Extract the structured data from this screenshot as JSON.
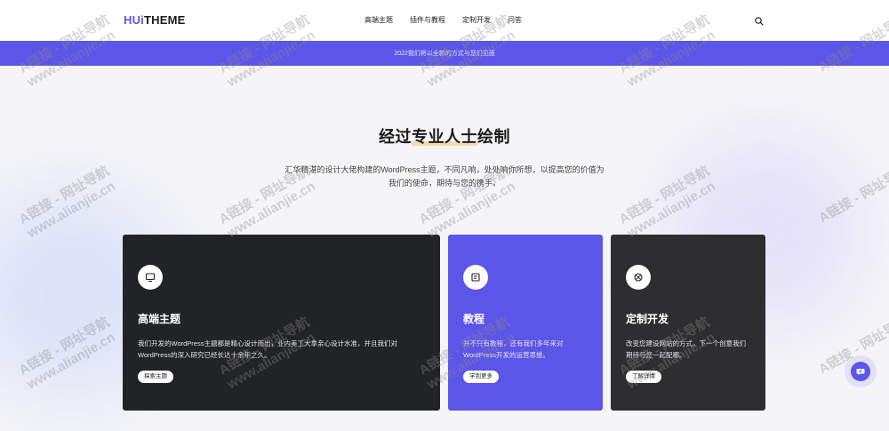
{
  "header": {
    "logo_accent": "HUi",
    "logo_rest": "THEME",
    "nav": [
      "高端主题",
      "插件与教程",
      "定制开发",
      "问答"
    ]
  },
  "announcement": "2022我们将以全新的方式与您们见面",
  "hero": {
    "title_prefix": "经过",
    "title_highlight": "专业人士",
    "title_suffix": "绘制",
    "description": "汇华精湛的设计大佬构建的WordPress主题，不同凡响，处处响你所想，以提高您的价值为我们的使命，期待与您的携手。"
  },
  "cards": [
    {
      "icon": "monitor-icon",
      "title": "高端主题",
      "desc": "我们开发的WordPress主题都是精心设计而出，业内美工大拿亲心设计水准，并且我们对WordPress的深入研究已经长达十余年之久。",
      "button": "探索主题",
      "bg": "#222326"
    },
    {
      "icon": "document-icon",
      "title": "教程",
      "desc": "并不只有教程，还有我们多年来对WordPress开发的运营思维。",
      "button": "学到更多",
      "bg": "#5b55e8"
    },
    {
      "icon": "sticker-icon",
      "title": "定制开发",
      "desc": "改变您建设网站的方式，下一个创意我们期待与您一起配哪。",
      "button": "了解详情",
      "bg": "#2e2e30"
    }
  ],
  "watermark": {
    "line1": "A链接 - 网址导航",
    "line2": "www.alianjie.cn"
  },
  "colors": {
    "brand": "#5b55e8",
    "dark_card": "#222326",
    "gray_card": "#2e2e30"
  }
}
